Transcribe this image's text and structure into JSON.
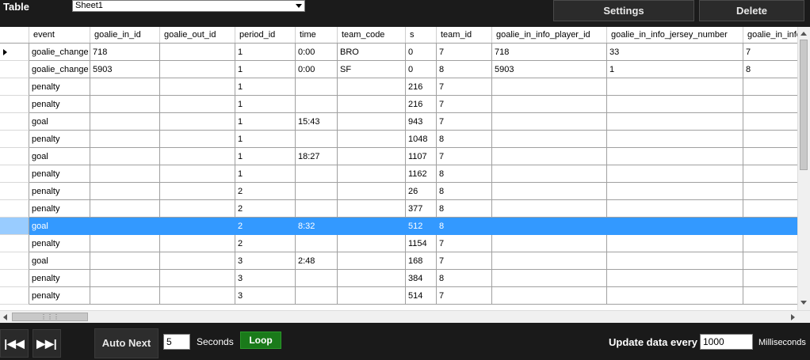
{
  "top": {
    "table_label": "Table",
    "sheet_select_value": "Sheet1",
    "settings_label": "Settings",
    "delete_label": "Delete"
  },
  "grid": {
    "columns": [
      "event",
      "goalie_in_id",
      "goalie_out_id",
      "period_id",
      "time",
      "team_code",
      "s",
      "team_id",
      "goalie_in_info_player_id",
      "goalie_in_info_jersey_number",
      "goalie_in_info_"
    ],
    "rows": [
      [
        "goalie_change",
        "718",
        "",
        "1",
        "0:00",
        "BRO",
        "0",
        "7",
        "718",
        "33",
        "7"
      ],
      [
        "goalie_change",
        "5903",
        "",
        "1",
        "0:00",
        "SF",
        "0",
        "8",
        "5903",
        "1",
        "8"
      ],
      [
        "penalty",
        "",
        "",
        "1",
        "",
        "",
        "216",
        "7",
        "",
        "",
        ""
      ],
      [
        "penalty",
        "",
        "",
        "1",
        "",
        "",
        "216",
        "7",
        "",
        "",
        ""
      ],
      [
        "goal",
        "",
        "",
        "1",
        "15:43",
        "",
        "943",
        "7",
        "",
        "",
        ""
      ],
      [
        "penalty",
        "",
        "",
        "1",
        "",
        "",
        "1048",
        "8",
        "",
        "",
        ""
      ],
      [
        "goal",
        "",
        "",
        "1",
        "18:27",
        "",
        "1107",
        "7",
        "",
        "",
        ""
      ],
      [
        "penalty",
        "",
        "",
        "1",
        "",
        "",
        "1162",
        "8",
        "",
        "",
        ""
      ],
      [
        "penalty",
        "",
        "",
        "2",
        "",
        "",
        "26",
        "8",
        "",
        "",
        ""
      ],
      [
        "penalty",
        "",
        "",
        "2",
        "",
        "",
        "377",
        "8",
        "",
        "",
        ""
      ],
      [
        "goal",
        "",
        "",
        "2",
        "8:32",
        "",
        "512",
        "8",
        "",
        "",
        ""
      ],
      [
        "penalty",
        "",
        "",
        "2",
        "",
        "",
        "1154",
        "7",
        "",
        "",
        ""
      ],
      [
        "goal",
        "",
        "",
        "3",
        "2:48",
        "",
        "168",
        "7",
        "",
        "",
        ""
      ],
      [
        "penalty",
        "",
        "",
        "3",
        "",
        "",
        "384",
        "8",
        "",
        "",
        ""
      ],
      [
        "penalty",
        "",
        "",
        "3",
        "",
        "",
        "514",
        "7",
        "",
        "",
        ""
      ]
    ],
    "selected_row": 10,
    "current_row": 0
  },
  "bottom": {
    "first_icon": "skip-to-start-icon",
    "next_icon": "skip-to-next-icon",
    "auto_next_label": "Auto Next",
    "seconds_value": "5",
    "seconds_label": "Seconds",
    "loop_label": "Loop",
    "update_label": "Update data every",
    "update_value": "1000",
    "ms_label": "Milliseconds"
  },
  "colors": {
    "selection": "#3399ff",
    "loop_green": "#1a7a1a",
    "background": "#1a1a1a"
  }
}
